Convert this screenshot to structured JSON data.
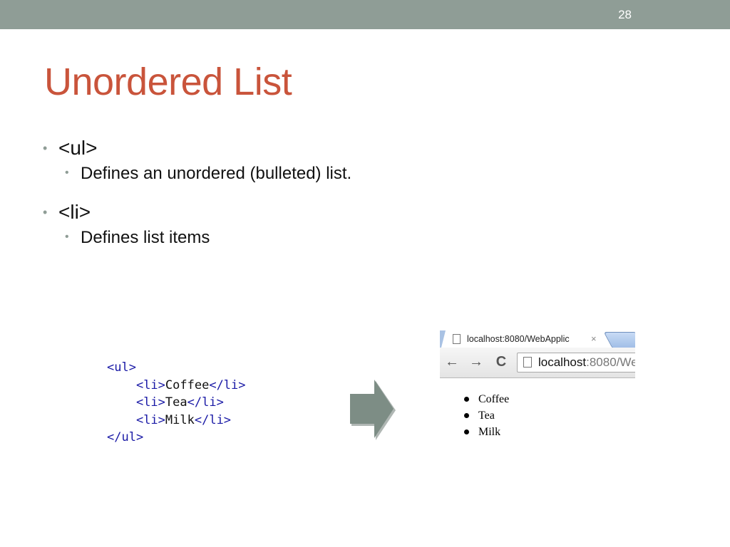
{
  "slide": {
    "number": "28",
    "title": "Unordered List",
    "title_color": "#c9543b",
    "bar_color": "#8f9d96",
    "bullets": [
      {
        "label": "<ul>",
        "sub": "Defines an unordered (bulleted) list."
      },
      {
        "label": "<li>",
        "sub": "Defines list items"
      }
    ]
  },
  "code_example": {
    "lines": [
      {
        "tag_open": "<ul>",
        "text": "",
        "tag_close": ""
      },
      {
        "tag_open": "<li>",
        "text": "Coffee",
        "tag_close": "</li>"
      },
      {
        "tag_open": "<li>",
        "text": "Tea",
        "tag_close": "</li>"
      },
      {
        "tag_open": "<li>",
        "text": "Milk",
        "tag_close": "</li>"
      },
      {
        "tag_open": "</ul>",
        "text": "",
        "tag_close": ""
      }
    ]
  },
  "arrow": {
    "icon": "right-arrow-icon",
    "color": "#7d8d85"
  },
  "browser": {
    "tab_title": "localhost:8080/WebApplic",
    "tab_close": "×",
    "back_icon": "←",
    "forward_icon": "→",
    "reload_icon": "C",
    "address_host": "localhost",
    "address_rest": ":8080/We",
    "list_items": [
      "Coffee",
      "Tea",
      "Milk"
    ]
  }
}
